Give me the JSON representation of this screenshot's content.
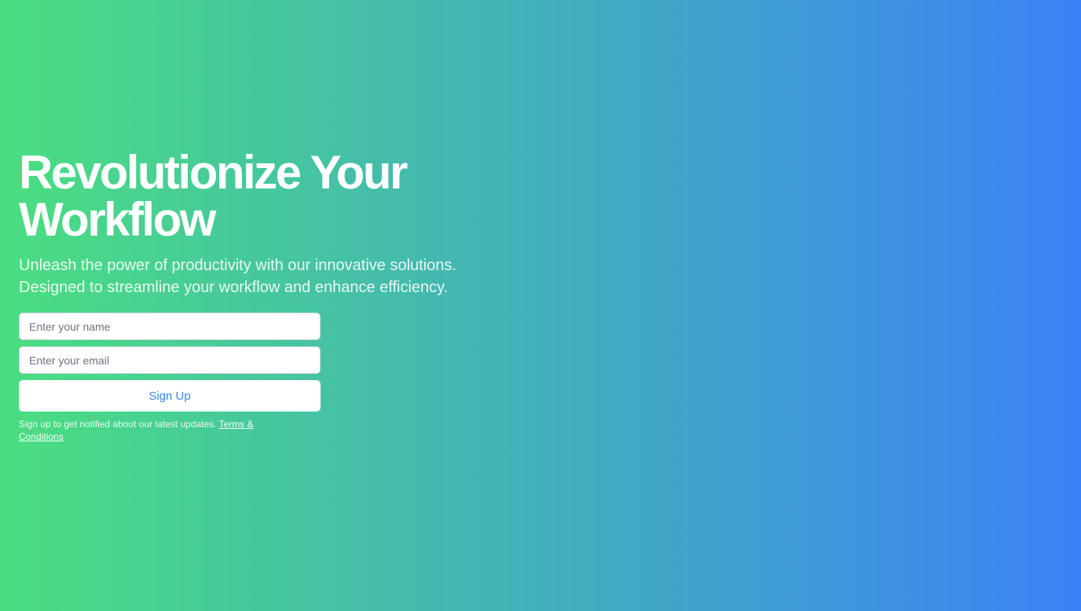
{
  "hero": {
    "headline": "Revolutionize Your Workflow",
    "subheadline": "Unleash the power of productivity with our innovative solutions. Designed to streamline your workflow and enhance efficiency."
  },
  "form": {
    "name_placeholder": "Enter your name",
    "email_placeholder": "Enter your email",
    "submit_label": "Sign Up",
    "notice_text": "Sign up to get notified about our latest updates. ",
    "terms_link": "Terms & Conditions"
  },
  "colors": {
    "gradient_start": "#4ade80",
    "gradient_end": "#3b82f6",
    "button_text": "#3b82f6"
  }
}
